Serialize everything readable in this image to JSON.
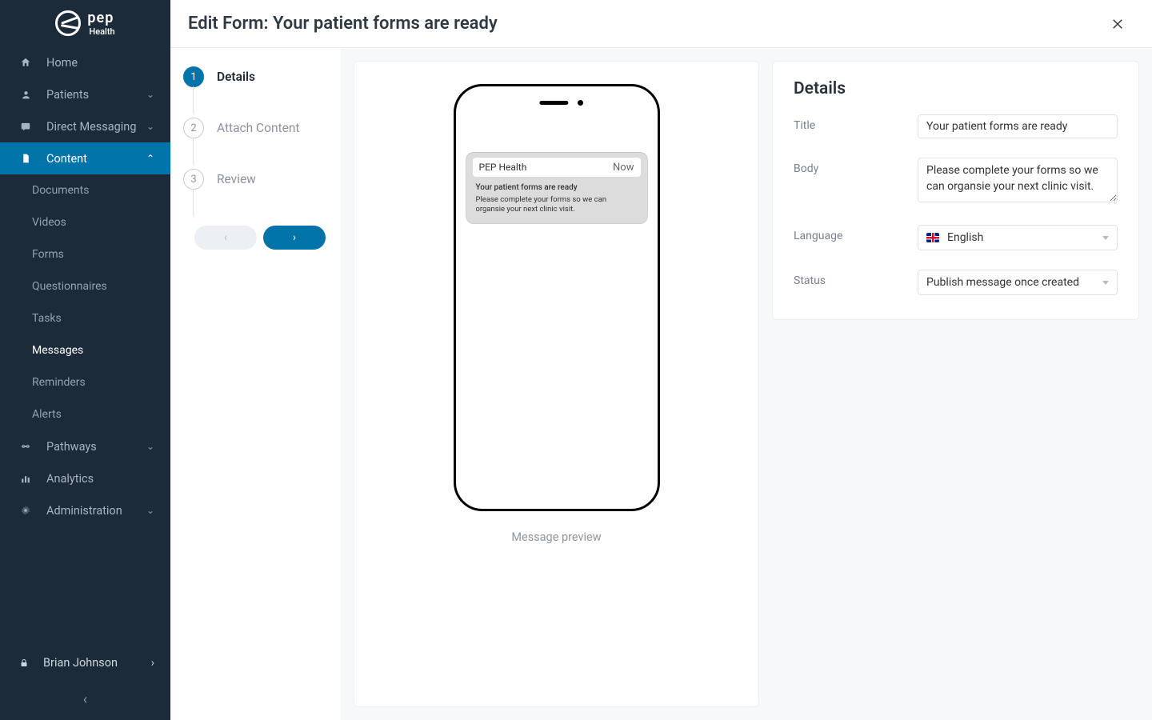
{
  "brand": {
    "name": "pep",
    "sub": "Health"
  },
  "sidebar": {
    "items": [
      {
        "label": "Home"
      },
      {
        "label": "Patients"
      },
      {
        "label": "Direct Messaging"
      },
      {
        "label": "Content"
      },
      {
        "label": "Pathways"
      },
      {
        "label": "Analytics"
      },
      {
        "label": "Administration"
      }
    ],
    "content_sub": [
      {
        "label": "Documents"
      },
      {
        "label": "Videos"
      },
      {
        "label": "Forms"
      },
      {
        "label": "Questionnaires"
      },
      {
        "label": "Tasks"
      },
      {
        "label": "Messages"
      },
      {
        "label": "Reminders"
      },
      {
        "label": "Alerts"
      }
    ],
    "user": "Brian Johnson"
  },
  "header": {
    "title": "Edit Form: Your patient forms are ready"
  },
  "stepper": {
    "steps": [
      {
        "num": "1",
        "label": "Details"
      },
      {
        "num": "2",
        "label": "Attach Content"
      },
      {
        "num": "3",
        "label": "Review"
      }
    ]
  },
  "preview": {
    "app_name": "PEP Health",
    "time": "Now",
    "title": "Your patient forms are ready",
    "body": "Please complete your forms so we can organsie your next clinic visit.",
    "caption": "Message preview"
  },
  "details": {
    "heading": "Details",
    "fields": {
      "title_label": "Title",
      "title_value": "Your patient forms are ready",
      "body_label": "Body",
      "body_value": "Please complete your forms so we can organsie your next clinic visit.",
      "language_label": "Language",
      "language_value": "English",
      "status_label": "Status",
      "status_value": "Publish message once created"
    }
  }
}
